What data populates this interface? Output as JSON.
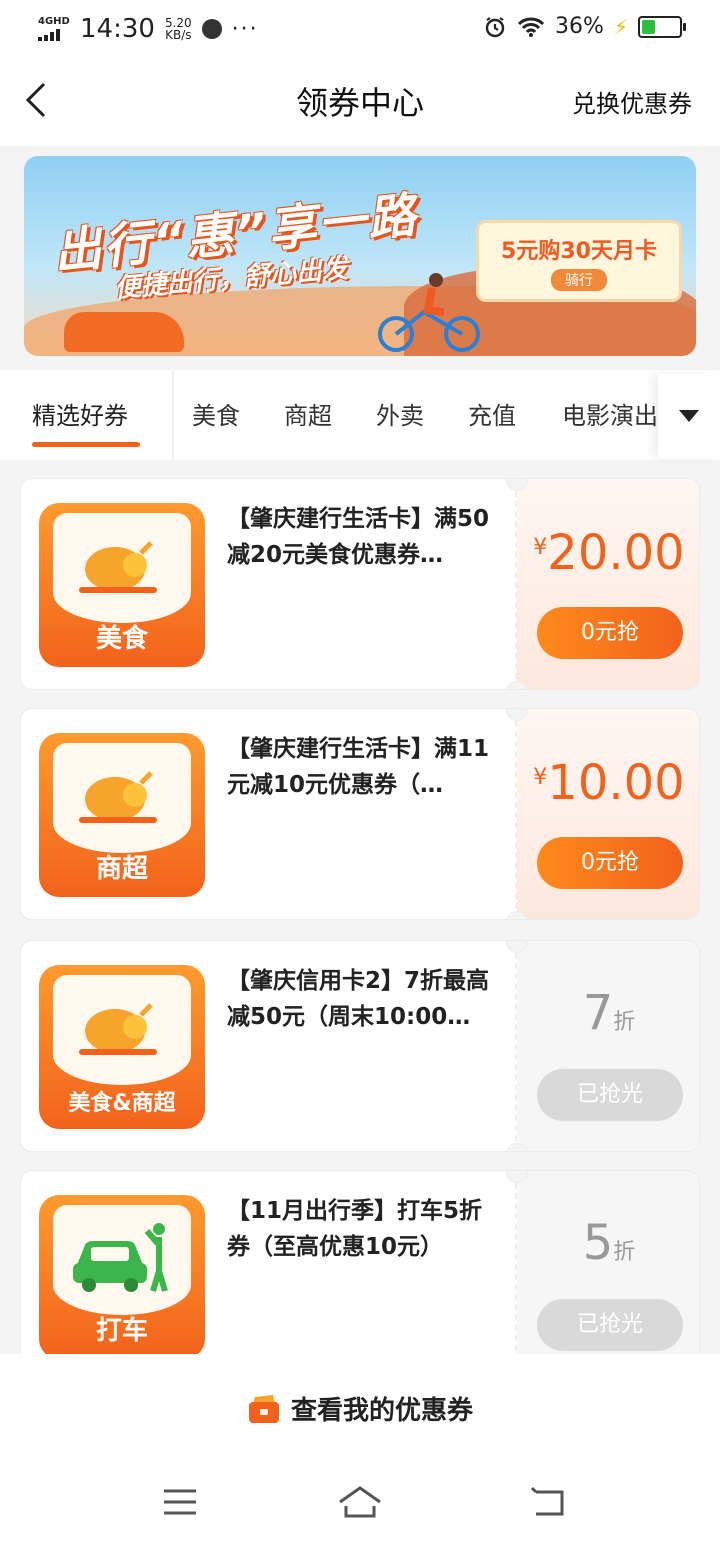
{
  "status_bar": {
    "network": "4GHD",
    "time": "14:30",
    "speed_value": "5.20",
    "speed_unit": "KB/s",
    "more": "···",
    "battery_percent": "36%",
    "battery_level": 0.36
  },
  "nav": {
    "title": "领券中心",
    "right_action": "兑换优惠券"
  },
  "banner": {
    "headline": "出行“惠”享一路",
    "subline": "便捷出行，舒心出发",
    "card_title": "5元购30天月卡",
    "card_tag": "骑行"
  },
  "tabs": [
    {
      "label": "精选好券",
      "active": true
    },
    {
      "label": "美食",
      "active": false
    },
    {
      "label": "商超",
      "active": false
    },
    {
      "label": "外卖",
      "active": false
    },
    {
      "label": "充值",
      "active": false
    },
    {
      "label": "电影演出",
      "active": false
    }
  ],
  "coupons": [
    {
      "category": "美食",
      "title": "【肇庆建行生活卡】满50减20元美食优惠券…",
      "currency": "¥",
      "amount": "20.00",
      "button": "0元抢",
      "state": "available",
      "icon": "roast-chicken-icon"
    },
    {
      "category": "商超",
      "title": "【肇庆建行生活卡】满11元减10元优惠券（…",
      "currency": "¥",
      "amount": "10.00",
      "button": "0元抢",
      "state": "available",
      "icon": "roast-chicken-icon"
    },
    {
      "category": "美食&商超",
      "title": "【肇庆信用卡2】7折最高减50元（周末10:00…",
      "discount": "7",
      "discount_unit": "折",
      "button": "已抢光",
      "state": "sold-out",
      "icon": "roast-chicken-icon"
    },
    {
      "category": "打车",
      "title": "【11月出行季】打车5折券（至高优惠10元）",
      "discount": "5",
      "discount_unit": "折",
      "button": "已抢光",
      "state": "sold-out",
      "icon": "taxi-icon"
    }
  ],
  "bottom": {
    "my_coupons": "查看我的优惠券"
  },
  "colors": {
    "accent": "#f2621c",
    "accent_light": "#ff8a1c",
    "sold_out": "#d9d9d9"
  }
}
